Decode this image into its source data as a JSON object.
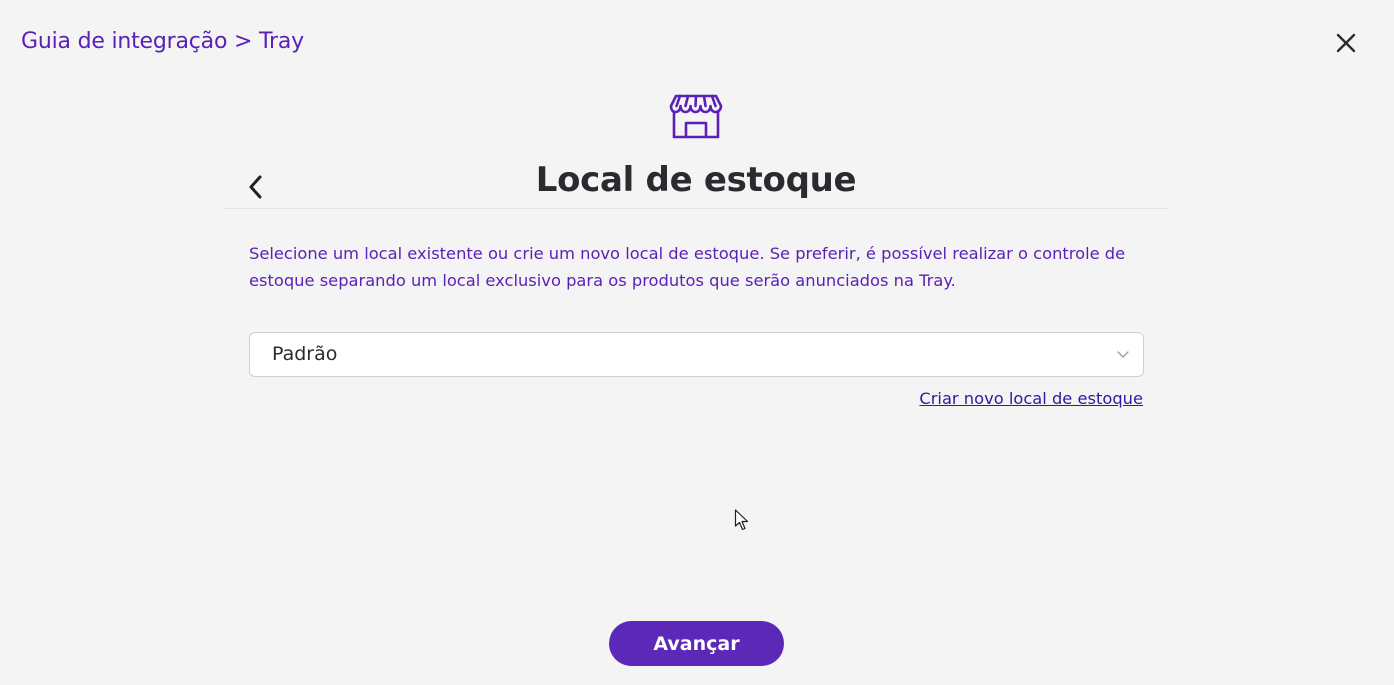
{
  "header": {
    "breadcrumb": "Guia de integração > Tray",
    "close_icon": "close-icon"
  },
  "step": {
    "icon": "store-icon",
    "title": "Local de estoque",
    "back_icon": "chevron-left-icon",
    "description": "Selecione um local existente ou crie um novo local de estoque. Se preferir, é possível realizar o controle de estoque separando um local exclusivo para os produtos que serão anunciados na Tray."
  },
  "stock_select": {
    "selected": "Padrão",
    "icon": "chevron-down-icon"
  },
  "create_link": "Criar novo local de estoque",
  "next_button": "Avançar",
  "colors": {
    "accent": "#5b21b6",
    "button": "#5b28b8",
    "background": "#f4f4f5",
    "title": "#2b2b2f",
    "link": "#2e1a9e"
  }
}
